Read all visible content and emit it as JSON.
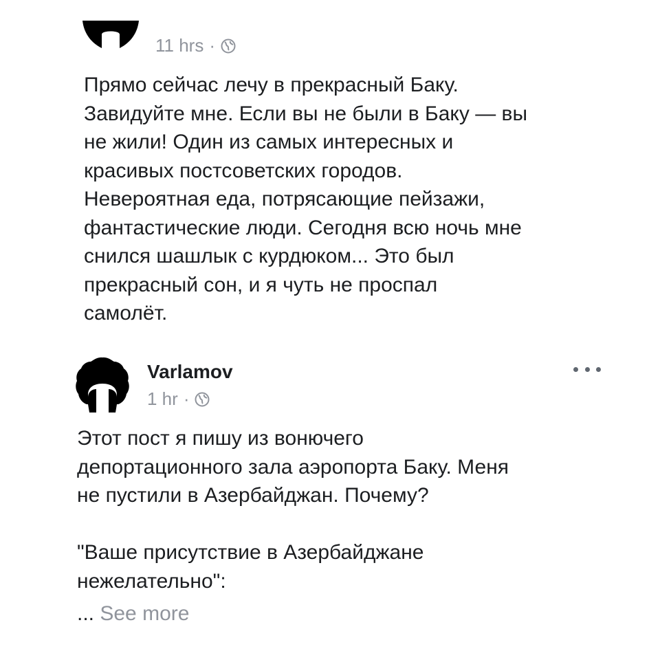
{
  "post1": {
    "time": "11 hrs",
    "separator": "·",
    "text": "Прямо сейчас лечу в прекрасный Баку.\nЗавидуйте мне. Если вы не были в Баку — вы\nне жили! Один из самых интересных и\nкрасивых постсоветских городов.\nНевероятная еда, потрясающие пейзажи,\nфантастические люди. Сегодня всю ночь мне\nснился шашлык с курдюком... Это был\nпрекрасный сон, и я чуть не проспал\nсамолёт."
  },
  "post2": {
    "author": "Varlamov",
    "time": "1 hr",
    "separator": "·",
    "text": "Этот пост я пишу из вонючего\nдепортационного зала аэропорта Баку. Меня\nне пустили в Азербайджан. Почему?\n\n\"Ваше присутствие в Азербайджане\nнежелательно\":",
    "ellipsis": "...",
    "see_more": "See more"
  },
  "icons": {
    "privacy": "globe-icon",
    "menu": "more-options-icon"
  },
  "colors": {
    "text": "#1c1e21",
    "meta": "#90949c"
  }
}
